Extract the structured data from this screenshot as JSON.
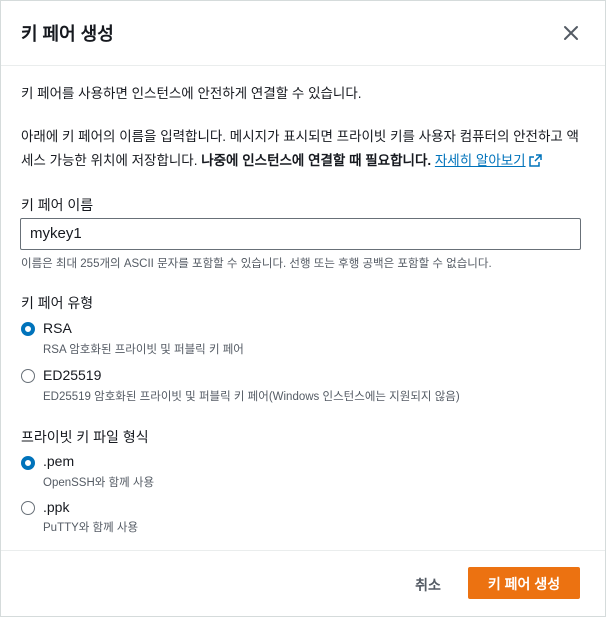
{
  "dialog": {
    "title": "키 페어 생성",
    "close_icon": "close-icon"
  },
  "intro": "키 페어를 사용하면 인스턴스에 안전하게 연결할 수 있습니다.",
  "description": {
    "text": "아래에 키 페어의 이름을 입력합니다. 메시지가 표시되면 프라이빗 키를 사용자 컴퓨터의 안전하고 액세스 가능한 위치에 저장합니다. ",
    "bold": "나중에 인스턴스에 연결할 때 필요합니다.",
    "link": "자세히 알아보기",
    "link_icon": "external-link-icon"
  },
  "name_field": {
    "label": "키 페어 이름",
    "value": "mykey1",
    "hint": "이름은 최대 255개의 ASCII 문자를 포함할 수 있습니다. 선행 또는 후행 공백은 포함할 수 없습니다."
  },
  "key_type": {
    "label": "키 페어 유형",
    "options": [
      {
        "label": "RSA",
        "description": "RSA 암호화된 프라이빗 및 퍼블릭 키 페어",
        "selected": true
      },
      {
        "label": "ED25519",
        "description": "ED25519 암호화된 프라이빗 및 퍼블릭 키 페어(Windows 인스턴스에는 지원되지 않음)",
        "selected": false
      }
    ]
  },
  "file_format": {
    "label": "프라이빗 키 파일 형식",
    "options": [
      {
        "label": ".pem",
        "description": "OpenSSH와 함께 사용",
        "selected": true
      },
      {
        "label": ".ppk",
        "description": "PuTTY와 함께 사용",
        "selected": false
      }
    ]
  },
  "footer": {
    "cancel_label": "취소",
    "create_label": "키 페어 생성"
  },
  "colors": {
    "primary_button": "#ec7211",
    "link": "#0073bb",
    "radio_selected": "#0073bb"
  }
}
